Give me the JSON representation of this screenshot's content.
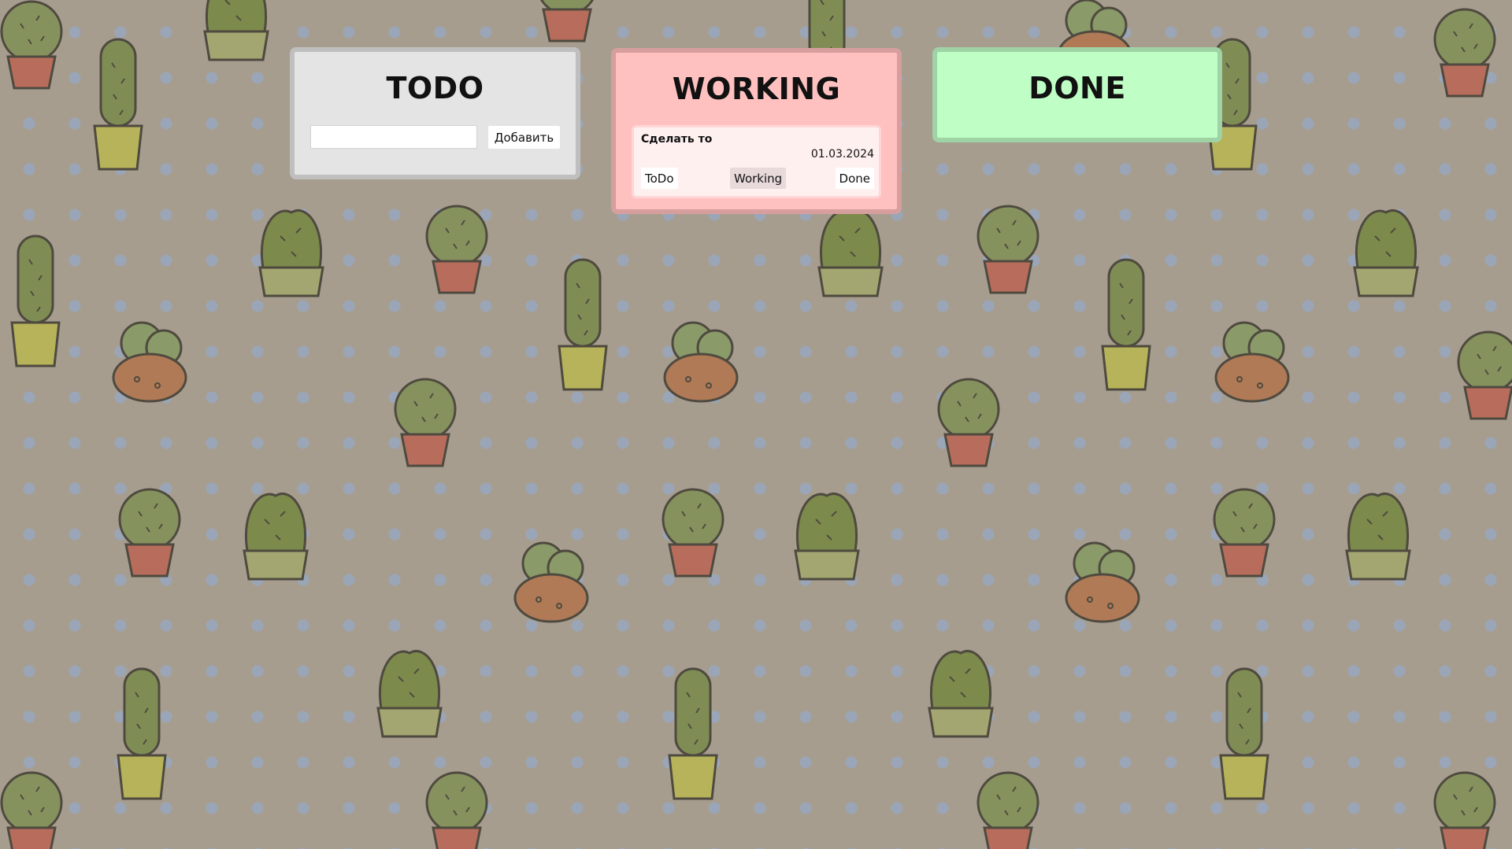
{
  "columns": {
    "todo": {
      "title": "TODO",
      "add_input_value": "",
      "add_button_label": "Добавить"
    },
    "working": {
      "title": "WORKING",
      "tasks": [
        {
          "title": "Сделать то",
          "date": "01.03.2024",
          "buttons": {
            "todo": "ToDo",
            "working": "Working",
            "done": "Done"
          }
        }
      ]
    },
    "done": {
      "title": "DONE"
    }
  },
  "colors": {
    "background": "#a69d8f",
    "todo_column": "#e4e4e4",
    "working_column": "#ffc0c0",
    "done_column": "#bfffc5",
    "task_card": "#fff0f0"
  },
  "icons": [
    "cactus-pattern-wallpaper"
  ]
}
